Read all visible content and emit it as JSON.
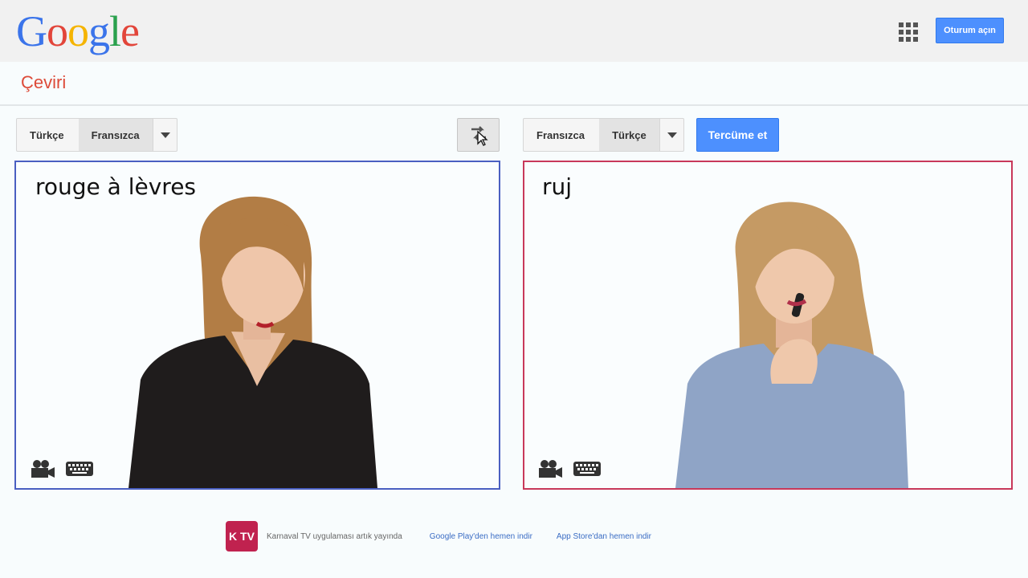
{
  "header": {
    "logo_letters": [
      {
        "ch": "G",
        "color": "#3b74ea"
      },
      {
        "ch": "o",
        "color": "#e2453a"
      },
      {
        "ch": "o",
        "color": "#f5b400"
      },
      {
        "ch": "g",
        "color": "#3b74ea"
      },
      {
        "ch": "l",
        "color": "#2aa14d"
      },
      {
        "ch": "e",
        "color": "#e2453a"
      }
    ],
    "signin_label": "Oturum açın",
    "apps_icon": "apps-grid-icon"
  },
  "page_title": "Çeviri",
  "source": {
    "languages": [
      "Türkçe",
      "Fransızca"
    ],
    "selected": "Fransızca",
    "text": "rouge à lèvres"
  },
  "target": {
    "languages": [
      "Fransızca",
      "Türkçe"
    ],
    "selected": "Türkçe",
    "text": "ruj"
  },
  "translate_label": "Tercüme et",
  "footer": {
    "brand": "K TV",
    "message": "Karnaval TV uygulaması artık yayında",
    "google_play_link": "Google Play'den hemen indir",
    "app_store_link": "App Store'dan hemen indir"
  },
  "colors": {
    "accent_blue": "#4d90fe",
    "brand_red": "#dd4b39",
    "source_border": "#4a5fc1",
    "target_border": "#c8385a"
  }
}
